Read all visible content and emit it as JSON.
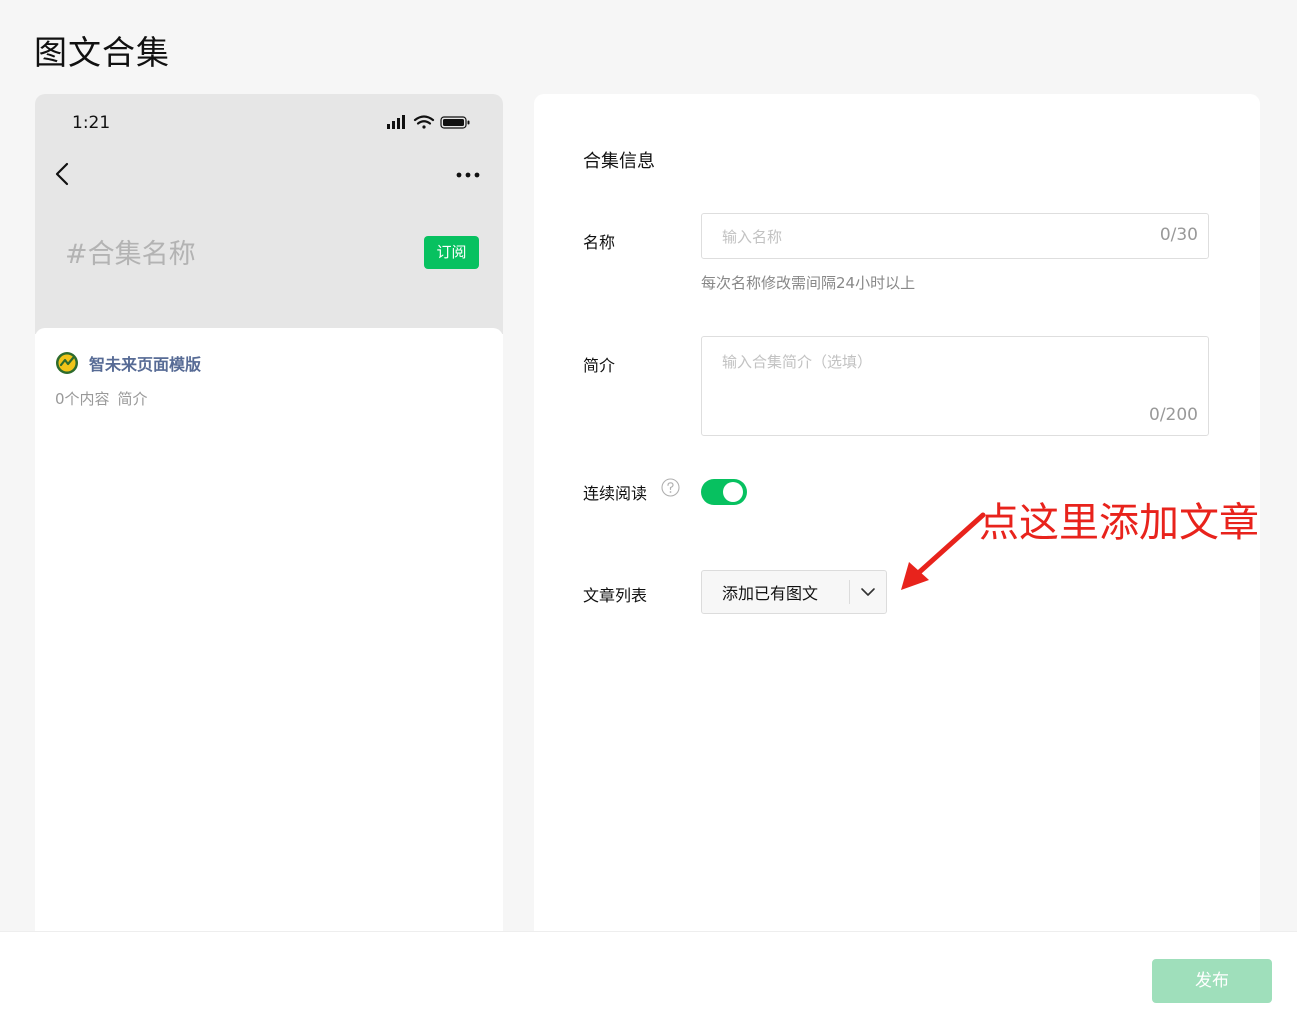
{
  "page": {
    "title": "图文合集"
  },
  "preview": {
    "status_time": "1:21",
    "collection_name_placeholder": "#合集名称",
    "subscribe_label": "订阅",
    "account_name": "智未来页面模版",
    "content_count": "0个内容",
    "intro_label": "简介"
  },
  "form": {
    "section_title": "合集信息",
    "name": {
      "label": "名称",
      "placeholder": "输入名称",
      "counter": "0/30",
      "hint": "每次名称修改需间隔24小时以上"
    },
    "intro": {
      "label": "简介",
      "placeholder": "输入合集简介（选填）",
      "counter": "0/200"
    },
    "continuous_read": {
      "label": "连续阅读",
      "enabled": true
    },
    "article_list": {
      "label": "文章列表",
      "button_label": "添加已有图文"
    }
  },
  "annotation": {
    "text": "点这里添加文章",
    "color": "#e8231c"
  },
  "footer": {
    "publish_label": "发布"
  },
  "colors": {
    "accent": "#07c160",
    "publish_disabled": "#9fdfbb",
    "link": "#576b95"
  }
}
